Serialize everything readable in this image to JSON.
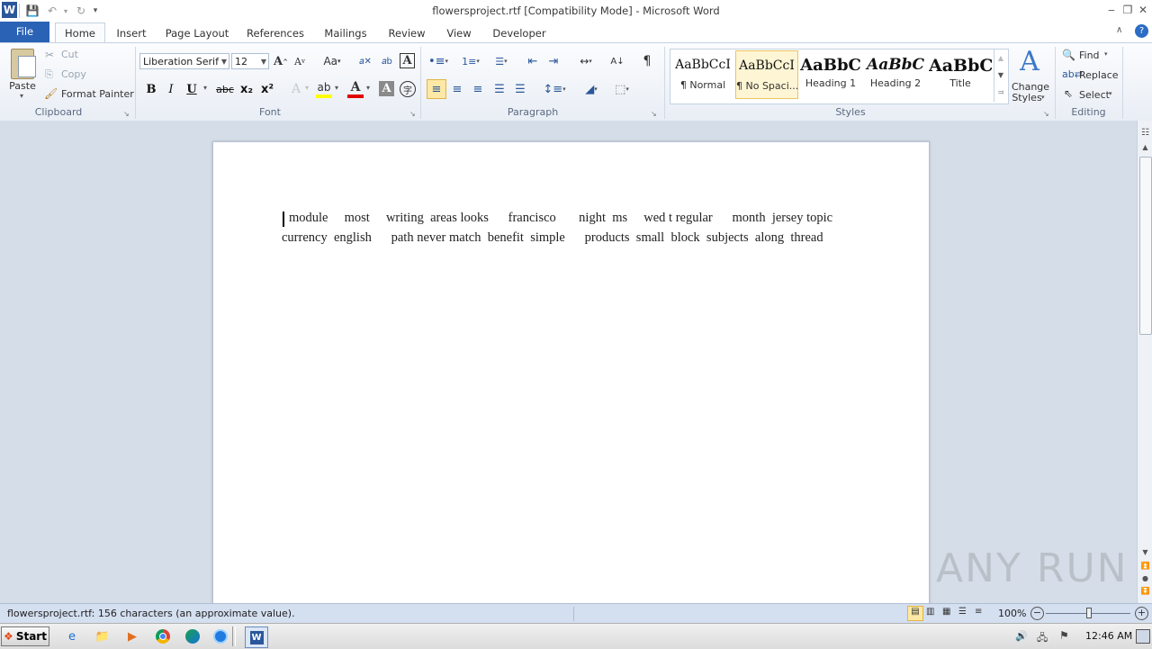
{
  "window": {
    "title": "flowersproject.rtf [Compatibility Mode]  -  Microsoft Word",
    "app_icon": "W"
  },
  "tabs": [
    "File",
    "Home",
    "Insert",
    "Page Layout",
    "References",
    "Mailings",
    "Review",
    "View",
    "Developer"
  ],
  "clipboard": {
    "paste": "Paste",
    "cut": "Cut",
    "copy": "Copy",
    "format_painter": "Format Painter",
    "group_label": "Clipboard"
  },
  "font": {
    "name": "Liberation Serif",
    "size": "12",
    "bold": "B",
    "italic": "I",
    "underline": "U",
    "strike": "abc",
    "subscript": "x₂",
    "superscript": "x²",
    "group_label": "Font",
    "colors": {
      "highlight": "#ffff00",
      "font_color": "#e00000"
    }
  },
  "paragraph": {
    "group_label": "Paragraph"
  },
  "styles": {
    "tiles": [
      {
        "preview": "AaBbCcI",
        "name": "¶ Normal"
      },
      {
        "preview": "AaBbCcI",
        "name": "¶ No Spaci..."
      },
      {
        "preview": "AaBbC",
        "name": "Heading 1"
      },
      {
        "preview": "AaBbC",
        "name": "Heading 2"
      },
      {
        "preview": "AaBbC",
        "name": "Title"
      }
    ],
    "change_styles_line1": "Change",
    "change_styles_line2": "Styles",
    "group_label": "Styles"
  },
  "editing": {
    "find": "Find",
    "replace": "Replace",
    "select": "Select",
    "group_label": "Editing"
  },
  "document": {
    "line1": "module     most     writing  areas looks      francisco       night  ms     wed t regular      month  jersey topic",
    "line2": "currency  english      path never match  benefit  simple      products  small  block  subjects  along  thread"
  },
  "status": {
    "left_text": "flowersproject.rtf: 156 characters (an approximate value).",
    "zoom": "100%"
  },
  "taskbar": {
    "start": "Start",
    "clock": "12:46 AM"
  },
  "watermark": "ANY RUN"
}
